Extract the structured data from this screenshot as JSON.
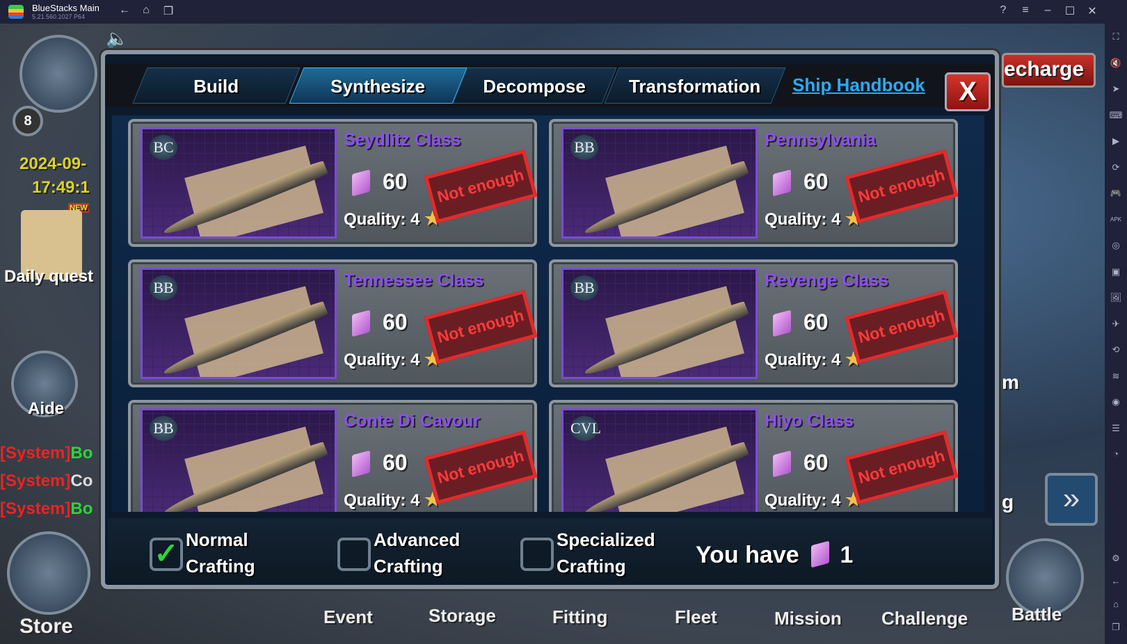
{
  "window": {
    "title": "BlueStacks Main",
    "version": "5.21.560.1027  P64"
  },
  "titlebar_icons": [
    "back-icon",
    "home-icon",
    "multi-instance-icon",
    "help-icon",
    "menu-icon",
    "minimize-icon",
    "maximize-icon",
    "close-icon"
  ],
  "sidebar_icons": [
    "fullscreen-icon",
    "volume-icon",
    "pointer-icon",
    "keyboard-icon",
    "macro-icon",
    "sync-icon",
    "controls-icon",
    "install-apk-icon",
    "screenshot-icon",
    "record-icon",
    "media-folder-icon",
    "airplane-icon",
    "rotate-icon",
    "shake-icon",
    "location-icon",
    "layers-icon",
    "eco-mode-icon",
    "settings-icon",
    "back-icon",
    "home-icon",
    "recent-apps-icon"
  ],
  "hud": {
    "level": "8",
    "date": "2024-09-",
    "time": "17:49:1",
    "new_badge": "NEW",
    "daily_quest": "Daily quest",
    "aide": "Aide",
    "recharge": "echarge",
    "right_partial_1": "m",
    "right_partial_2": "g",
    "chat": [
      {
        "tag": "[System]",
        "text": "Bo",
        "color": "#2fd23a"
      },
      {
        "tag": "[System]",
        "text": "Co",
        "color": "#dddddd"
      },
      {
        "tag": "[System]",
        "text": "Bo",
        "color": "#2fd23a"
      }
    ]
  },
  "dialog": {
    "tabs": [
      {
        "label": "Build",
        "active": false
      },
      {
        "label": "Synthesize",
        "active": true
      },
      {
        "label": "Decompose",
        "active": false
      },
      {
        "label": "Transformation",
        "active": false
      }
    ],
    "handbook": "Ship Handbook",
    "close": "X",
    "cards": [
      {
        "type": "BC",
        "name": "Seydlitz Class",
        "cost": "60",
        "quality": "Quality: 4",
        "stamp": "Not enough"
      },
      {
        "type": "BB",
        "name": "Pennsylvania",
        "cost": "60",
        "quality": "Quality: 4",
        "stamp": "Not enough"
      },
      {
        "type": "BB",
        "name": "Tennessee Class",
        "cost": "60",
        "quality": "Quality: 4",
        "stamp": "Not enough"
      },
      {
        "type": "BB",
        "name": "Revenge Class",
        "cost": "60",
        "quality": "Quality: 4",
        "stamp": "Not enough"
      },
      {
        "type": "BB",
        "name": "Conte Di Cavour",
        "cost": "60",
        "quality": "Quality: 4",
        "stamp": "Not enough"
      },
      {
        "type": "CVL",
        "name": "Hiyo Class",
        "cost": "60",
        "quality": "Quality: 4",
        "stamp": "Not enough"
      }
    ],
    "crafting": [
      {
        "line1": "Normal",
        "line2": "Crafting",
        "checked": true
      },
      {
        "line1": "Advanced",
        "line2": "Crafting",
        "checked": false
      },
      {
        "line1": "Specialized",
        "line2": "Crafting",
        "checked": false
      }
    ],
    "you_have": "You have",
    "owned": "1"
  },
  "bottom_nav": [
    "Store",
    "Event",
    "Storage",
    "Fitting",
    "Fleet",
    "Mission",
    "Challenge",
    "Battle"
  ]
}
